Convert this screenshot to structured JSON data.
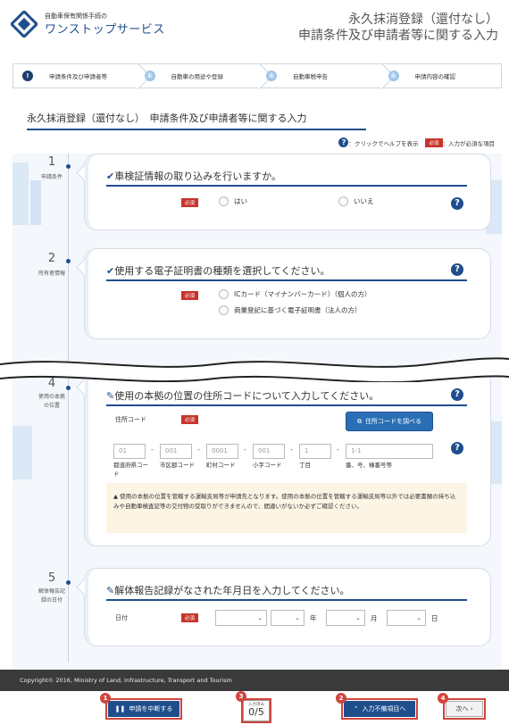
{
  "header": {
    "brand_small": "自動車保有関係手続の",
    "brand_big": "ワンストップサービス",
    "title_line1": "永久抹消登録（還付なし）",
    "title_line2": "申請条件及び申請者等に関する入力"
  },
  "steps": [
    {
      "icon": "!",
      "label": "申請条件及び申請者等",
      "active": true
    },
    {
      "icon": "未",
      "label": "自動車の用途や登録",
      "active": false
    },
    {
      "icon": "未",
      "label": "自動車税申告",
      "active": false
    },
    {
      "icon": "未",
      "label": "申請内容の確認",
      "active": false
    }
  ],
  "page": {
    "title": "永久抹消登録（還付なし）　申請条件及び申請者等に関する入力",
    "help_legend": "：クリックでヘルプを表示",
    "required_legend": "：入力が必須な項目",
    "required_badge": "必須",
    "help_glyph": "?"
  },
  "sections": {
    "s1": {
      "num": "1",
      "label": "申請条件",
      "question": "車検証情報の取り込みを行いますか。",
      "options": [
        "はい",
        "いいえ"
      ]
    },
    "s2": {
      "num": "2",
      "label": "所有者情報",
      "question": "使用する電子証明書の種類を選択してください。",
      "options": [
        "ICカード（マイナンバーカード）（個人の方）",
        "商業登記に基づく電子証明書（法人の方）"
      ]
    },
    "s4": {
      "num": "4",
      "label": "使用の本拠の位置",
      "question": "使用の本拠の位置の住所コードについて入力してください。",
      "field_label": "住所コード",
      "lookup_button": "住所コードを調べる",
      "fields": [
        {
          "placeholder": "01",
          "caption": "都道府県コード"
        },
        {
          "placeholder": "001",
          "caption": "市区郡コード"
        },
        {
          "placeholder": "0001",
          "caption": "町村コード"
        },
        {
          "placeholder": "001",
          "caption": "小字コード"
        },
        {
          "placeholder": "1",
          "caption": "丁目"
        },
        {
          "placeholder": "1-1",
          "caption": "番、号、棟番号等"
        }
      ],
      "notice": "▲ 使用の本拠の位置を管轄する運輸支局等が申請先となります。使用の本拠の位置を管轄する運輸支局等以外では必要書類の持ち込みや自動車検査証等の交付物の受取りができませんので、間違いがないか必ずご確認ください。"
    },
    "s5": {
      "num": "5",
      "label": "解体報告記録の日付",
      "question": "解体報告記録がなされた年月日を入力してください。",
      "field_label": "日付",
      "units": [
        "年",
        "月",
        "日"
      ]
    }
  },
  "footer": {
    "copyright": "Copyright© 2016, Ministry of Land, Infrastructure, Transport and Tourism"
  },
  "bottom": {
    "suspend_button": "申請を中断する",
    "progress_caption": "入力済み",
    "progress_value": "0/5",
    "missing_button": "入力不備項目へ",
    "next_button": "次へ ›",
    "markers": [
      "1",
      "2",
      "3",
      "4"
    ]
  }
}
